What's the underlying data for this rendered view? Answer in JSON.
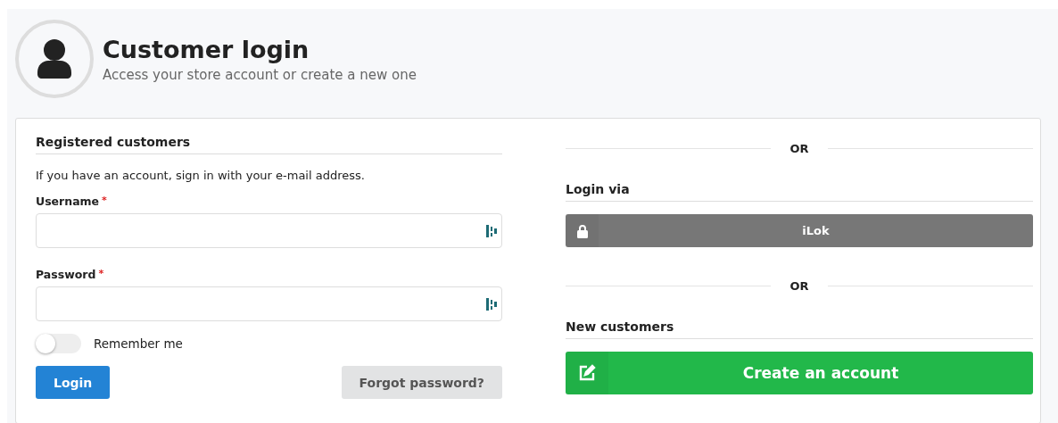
{
  "header": {
    "title": "Customer login",
    "subtitle": "Access your store account or create a new one"
  },
  "registered": {
    "heading": "Registered customers",
    "intro": "If you have an account, sign in with your e-mail address.",
    "fields": [
      {
        "label": "Username",
        "required_mark": "*"
      },
      {
        "label": "Password",
        "required_mark": "*"
      }
    ],
    "remember": {
      "label": "Remember me",
      "on": false
    },
    "login_button": "Login",
    "forgot_button": "Forgot password?"
  },
  "alternatives": [
    {
      "kind": "separator",
      "text": "OR"
    },
    {
      "kind": "heading",
      "text": "Login via"
    },
    {
      "kind": "provider_button",
      "text": "iLok"
    },
    {
      "kind": "separator",
      "text": "OR"
    },
    {
      "kind": "heading",
      "text": "New customers"
    },
    {
      "kind": "create_button",
      "text": "Create an account"
    }
  ]
}
